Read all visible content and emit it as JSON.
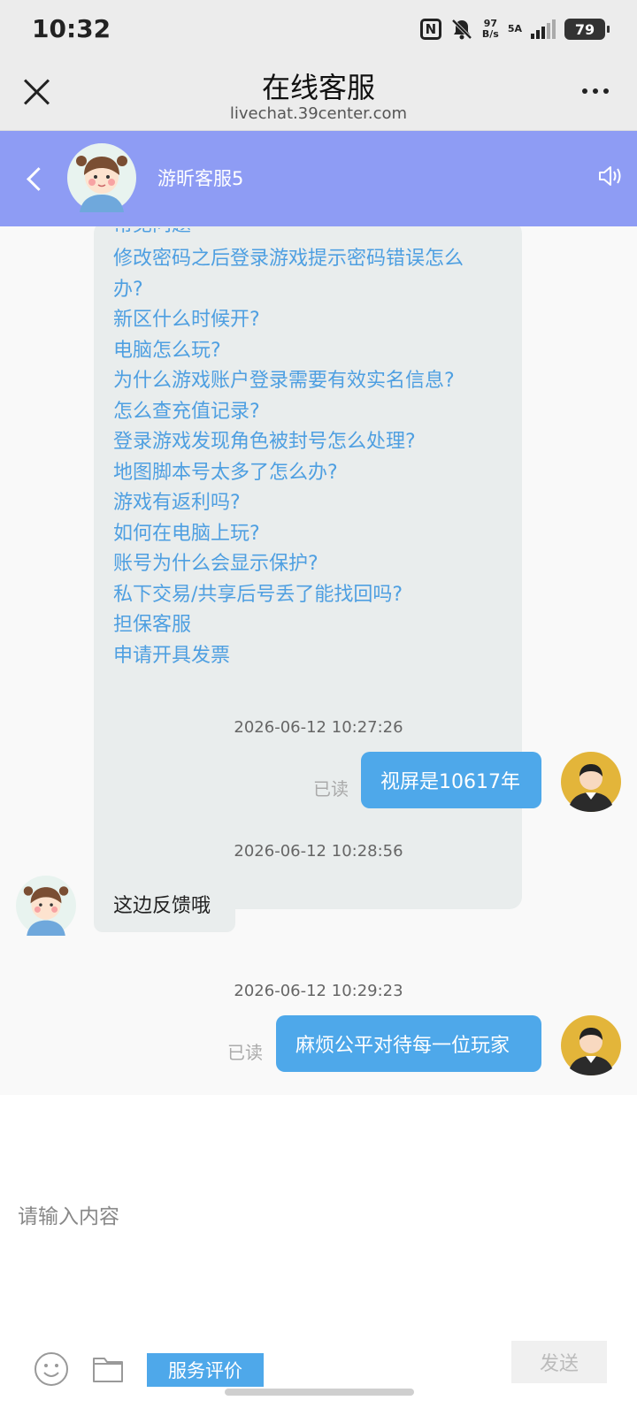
{
  "status_bar": {
    "time": "10:32",
    "nfc": "N",
    "net_speed_value": "97",
    "net_speed_unit": "B/s",
    "network": "5A",
    "battery": "79"
  },
  "titlebar": {
    "title": "在线客服",
    "url": "livechat.39center.com"
  },
  "chat_header": {
    "agent_name": "游昕客服5"
  },
  "faq": {
    "partial_top": "常见问题",
    "links": [
      "修改密码之后登录游戏提示密码错误怎么",
      "办?",
      "新区什么时候开?",
      "电脑怎么玩?",
      "为什么游戏账户登录需要有效实名信息?",
      "怎么查充值记录?",
      "登录游戏发现角色被封号怎么处理?",
      "地图脚本号太多了怎么办?",
      "游戏有返利吗?",
      "如何在电脑上玩?",
      "账号为什么会显示保护?",
      "私下交易/共享后号丢了能找回吗?",
      "担保客服",
      "申请开具发票"
    ]
  },
  "messages": [
    {
      "timestamp": "2026-06-12 10:27:26",
      "text": "视屏是10617年",
      "read_label": "已读"
    },
    {
      "timestamp": "2026-06-12 10:28:56",
      "text": "这边反馈哦"
    },
    {
      "timestamp": "2026-06-12 10:29:23",
      "text": "麻烦公平对待每一位玩家",
      "read_label": "已读"
    }
  ],
  "input": {
    "placeholder": "请输入内容",
    "rate_label": "服务评价",
    "send_label": "发送"
  },
  "colors": {
    "header_bg": "#8e9cf4",
    "accent": "#4ea8ea",
    "link": "#4e9fe1"
  }
}
